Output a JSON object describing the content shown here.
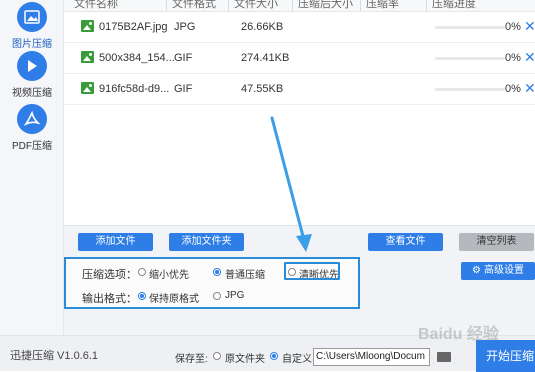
{
  "sidebar": {
    "items": [
      {
        "label": "图片压缩",
        "icon": "image-icon"
      },
      {
        "label": "视频压缩",
        "icon": "play-icon"
      },
      {
        "label": "PDF压缩",
        "icon": "pdf-icon"
      }
    ]
  },
  "table": {
    "headers": [
      "文件名称",
      "文件格式",
      "文件大小",
      "压缩后大小",
      "压缩率",
      "压缩进度"
    ],
    "rows": [
      {
        "name": "0175B2AF.jpg",
        "format": "JPG",
        "size": "26.66KB",
        "progress": "0%",
        "progress_value": 0
      },
      {
        "name": "500x384_154...",
        "format": "GIF",
        "size": "274.41KB",
        "progress": "0%",
        "progress_value": 0
      },
      {
        "name": "916fc58d-d9...",
        "format": "GIF",
        "size": "47.55KB",
        "progress": "0%",
        "progress_value": 0
      }
    ]
  },
  "actions": {
    "add_file": "添加文件",
    "add_folder": "添加文件夹",
    "view_file": "查看文件",
    "clear_list": "清空列表",
    "advanced": "高级设置"
  },
  "options": {
    "compress_label": "压缩选项：",
    "compress_choices": [
      {
        "label": "缩小优先",
        "selected": false
      },
      {
        "label": "普通压缩",
        "selected": true
      },
      {
        "label": "清晰优先",
        "selected": false
      }
    ],
    "format_label": "输出格式：",
    "format_choices": [
      {
        "label": "保持原格式",
        "selected": true
      },
      {
        "label": "JPG",
        "selected": false
      }
    ]
  },
  "footer": {
    "version": "迅捷压缩 V1.0.6.1",
    "save_to_label": "保存至:",
    "save_choices": [
      {
        "label": "原文件夹",
        "selected": false
      },
      {
        "label": "自定义",
        "selected": true
      }
    ],
    "path_value": "C:\\Users\\Mloong\\Docum",
    "start_button": "开始压缩"
  },
  "watermark": "Baidu 经验",
  "colors": {
    "accent": "#2f7ee8",
    "highlight_border": "#2a8bd8",
    "annotation_arrow": "#3a9ee8",
    "file_icon": "#3a9b3a"
  }
}
